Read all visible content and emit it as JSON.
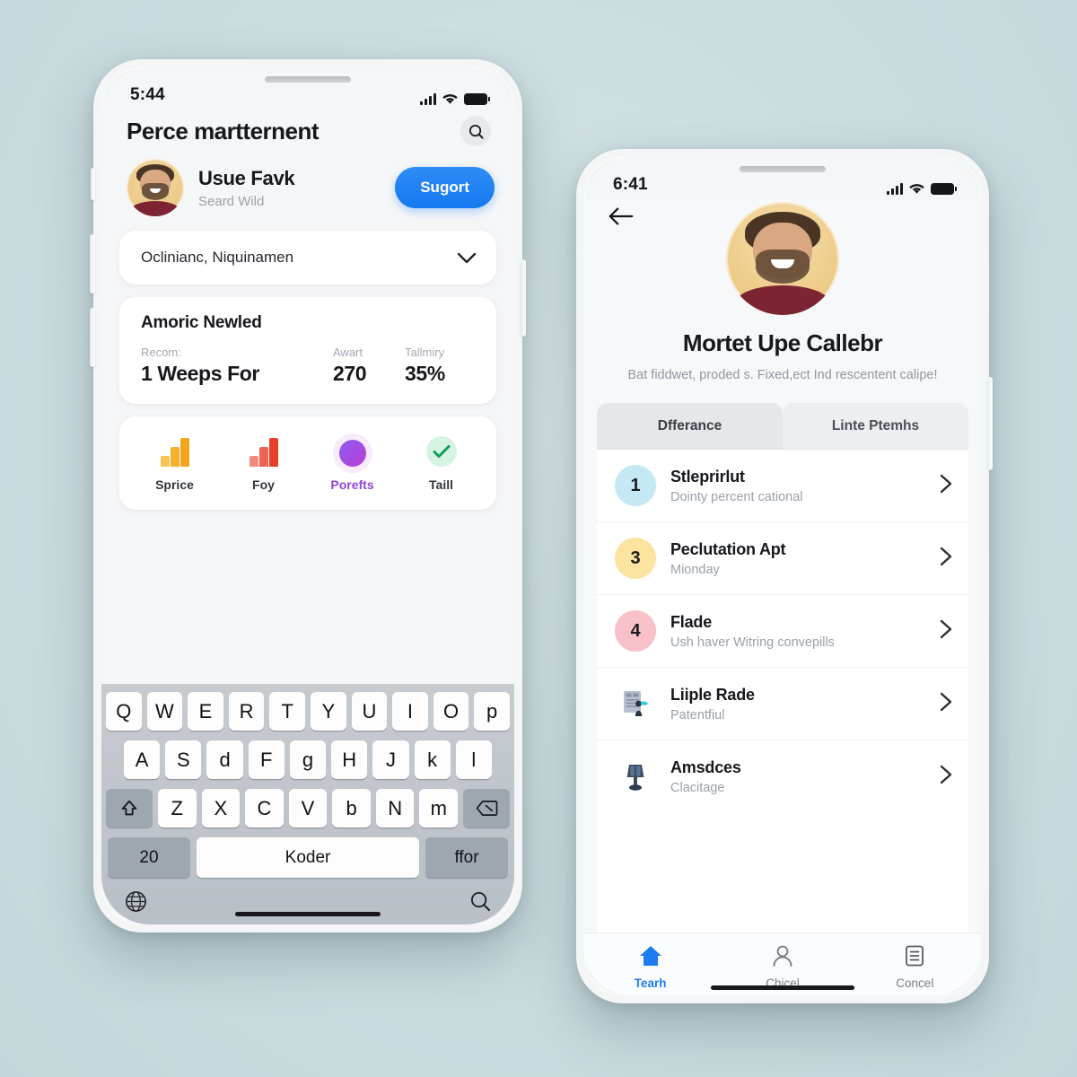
{
  "theme": {
    "background": "#cadcde",
    "accent_blue": "#1479f0",
    "accent_purple": "#9147d6",
    "accent_green": "#0f9d58"
  },
  "left_phone": {
    "status": {
      "time": "5:44",
      "signal_icon": "cellular-bars-icon",
      "wifi_icon": "wifi-icon",
      "battery_icon": "battery-full-icon"
    },
    "header": {
      "title": "Perce martternent",
      "search_icon": "search-icon"
    },
    "profile": {
      "name": "Usue Favk",
      "subtitle": "Seard Wild",
      "action_label": "Sugort",
      "avatar_icon": "user-avatar"
    },
    "dropdown": {
      "value": "Oclinianc, Niquinamen",
      "chevron_icon": "chevron-down-icon"
    },
    "stats": {
      "title": "Amoric Newled",
      "items": [
        {
          "label": "Recom:",
          "value": "1 Weeps For"
        },
        {
          "label": "Awart",
          "value": "270"
        },
        {
          "label": "Tallmiry",
          "value": "35%"
        }
      ]
    },
    "quick_actions": [
      {
        "label": "Sprice",
        "icon": "bar-chart-orange-icon"
      },
      {
        "label": "Foy",
        "icon": "bar-chart-red-icon"
      },
      {
        "label": "Porefts",
        "icon": "purple-dot-icon"
      },
      {
        "label": "Taill",
        "icon": "check-circle-icon"
      }
    ],
    "keyboard": {
      "row1": [
        "Q",
        "W",
        "E",
        "R",
        "T",
        "Y",
        "U",
        "I",
        "O",
        "p"
      ],
      "row2": [
        "A",
        "S",
        "d",
        "F",
        "g",
        "H",
        "J",
        "k",
        "l"
      ],
      "row3": [
        "Z",
        "X",
        "C",
        "V",
        "b",
        "N",
        "m"
      ],
      "shift_icon": "shift-icon",
      "backspace_icon": "backspace-icon",
      "num_key": "20",
      "space_key": "Koder",
      "return_key": "ffor",
      "globe_icon": "globe-icon",
      "mic_search_icon": "search-icon"
    }
  },
  "right_phone": {
    "status": {
      "time": "6:41",
      "signal_icon": "cellular-bars-icon",
      "wifi_icon": "wifi-icon",
      "battery_icon": "battery-full-icon"
    },
    "back_icon": "back-arrow-icon",
    "profile": {
      "avatar_icon": "user-avatar",
      "name": "Mortet Upe Callebr",
      "description": "Bat fiddwet, proded s. Fixed,ect Ind rescentent calipe!"
    },
    "tabs": [
      {
        "label": "Dfferance",
        "active": true
      },
      {
        "label": "Linte Ptemhs",
        "active": false
      }
    ],
    "list": [
      {
        "badge": "1",
        "badge_color": "#c5e8f5",
        "title": "Stleprirlut",
        "subtitle": "Dointy percent cational",
        "chevron_icon": "chevron-right-icon"
      },
      {
        "badge": "3",
        "badge_color": "#fbe3a0",
        "title": "Peclutation Apt",
        "subtitle": "Mionday",
        "chevron_icon": "chevron-right-icon"
      },
      {
        "badge": "4",
        "badge_color": "#f8c0c8",
        "title": "Flade",
        "subtitle": "Ush haver Witring convepills",
        "chevron_icon": "chevron-right-icon"
      },
      {
        "badge": "",
        "icon": "document-person-icon",
        "title": "Liiple Rade",
        "subtitle": "Patentfiul",
        "chevron_icon": "chevron-right-icon"
      },
      {
        "badge": "",
        "icon": "lamp-icon",
        "title": "Amsdces",
        "subtitle": "Clacitage",
        "chevron_icon": "chevron-right-icon"
      }
    ],
    "tabbar": [
      {
        "label": "Tearh",
        "icon": "home-icon",
        "active": true
      },
      {
        "label": "Chicel",
        "icon": "person-icon",
        "active": false
      },
      {
        "label": "Concel",
        "icon": "document-icon",
        "active": false
      }
    ]
  }
}
